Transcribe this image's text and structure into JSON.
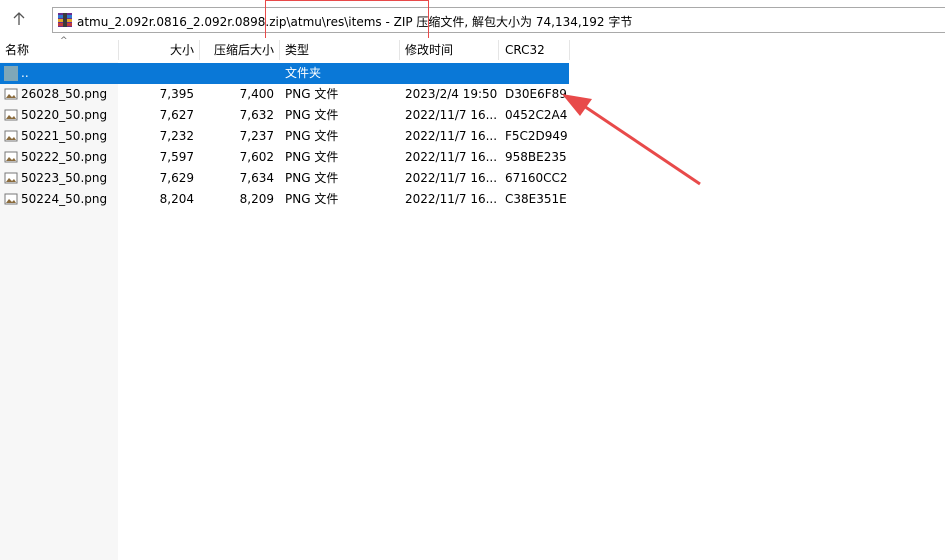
{
  "toolbar": {
    "up_icon": "arrow-up-icon"
  },
  "address": {
    "icon": "winrar-archive-icon",
    "text": "atmu_2.092r.0816_2.092r.0898.zip\\atmu\\res\\items - ZIP 压缩文件, 解包大小为 74,134,192 字节"
  },
  "columns": {
    "name": "名称",
    "size": "大小",
    "packed": "压缩后大小",
    "type": "类型",
    "modified": "修改时间",
    "crc": "CRC32"
  },
  "parent_row": {
    "name": "..",
    "type": "文件夹"
  },
  "rows": [
    {
      "name": "26028_50.png",
      "size": "7,395",
      "packed": "7,400",
      "type": "PNG 文件",
      "modified": "2023/2/4 19:50",
      "crc": "D30E6F89"
    },
    {
      "name": "50220_50.png",
      "size": "7,627",
      "packed": "7,632",
      "type": "PNG 文件",
      "modified": "2022/11/7 16...",
      "crc": "0452C2A4"
    },
    {
      "name": "50221_50.png",
      "size": "7,232",
      "packed": "7,237",
      "type": "PNG 文件",
      "modified": "2022/11/7 16...",
      "crc": "F5C2D949"
    },
    {
      "name": "50222_50.png",
      "size": "7,597",
      "packed": "7,602",
      "type": "PNG 文件",
      "modified": "2022/11/7 16...",
      "crc": "958BE235"
    },
    {
      "name": "50223_50.png",
      "size": "7,629",
      "packed": "7,634",
      "type": "PNG 文件",
      "modified": "2022/11/7 16...",
      "crc": "67160CC2"
    },
    {
      "name": "50224_50.png",
      "size": "8,204",
      "packed": "8,209",
      "type": "PNG 文件",
      "modified": "2022/11/7 16...",
      "crc": "C38E351E"
    }
  ],
  "colors": {
    "selection": "#0a78d7",
    "annotation": "#e84a4a"
  }
}
